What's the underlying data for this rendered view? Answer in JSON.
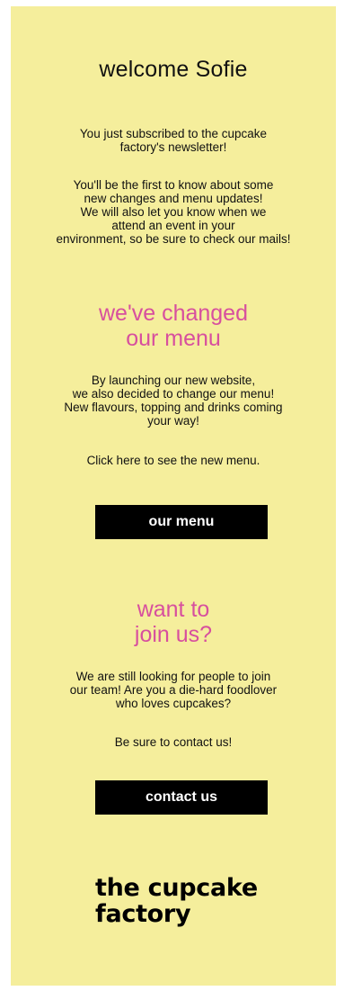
{
  "email": {
    "greeting": "welcome Sofie",
    "intro": {
      "line1": "You just subscribed to the cupcake",
      "line2": "factory's newsletter!"
    },
    "details": {
      "line1": "You'll be the first to know about some",
      "line2": "new changes and menu updates!",
      "line3": "We will also let you know when we",
      "line4": "attend an event in your",
      "line5": "environment, so be sure to check our mails!"
    },
    "menu_section": {
      "heading_line1": "we've changed",
      "heading_line2": "our menu",
      "body_line1": "By launching our new website,",
      "body_line2": "we also decided to change our menu!",
      "body_line3": "New flavours, topping and drinks coming",
      "body_line4": "your way!",
      "cta_text": "Click here to see the new menu.",
      "button_label": "our menu"
    },
    "join_section": {
      "heading_line1": "want to",
      "heading_line2": "join us?",
      "body_line1": "We are still looking for people to join",
      "body_line2": "our team! Are you a die-hard foodlover",
      "body_line3": "who loves cupcakes?",
      "cta_text": "Be sure to contact us!",
      "button_label": "contact us"
    },
    "logo": {
      "line1": "the cupcake",
      "line2": "factory"
    }
  },
  "colors": {
    "background": "#f5ee9c",
    "accent": "#d74f9e",
    "button": "#000000",
    "button_text": "#ffffff"
  }
}
